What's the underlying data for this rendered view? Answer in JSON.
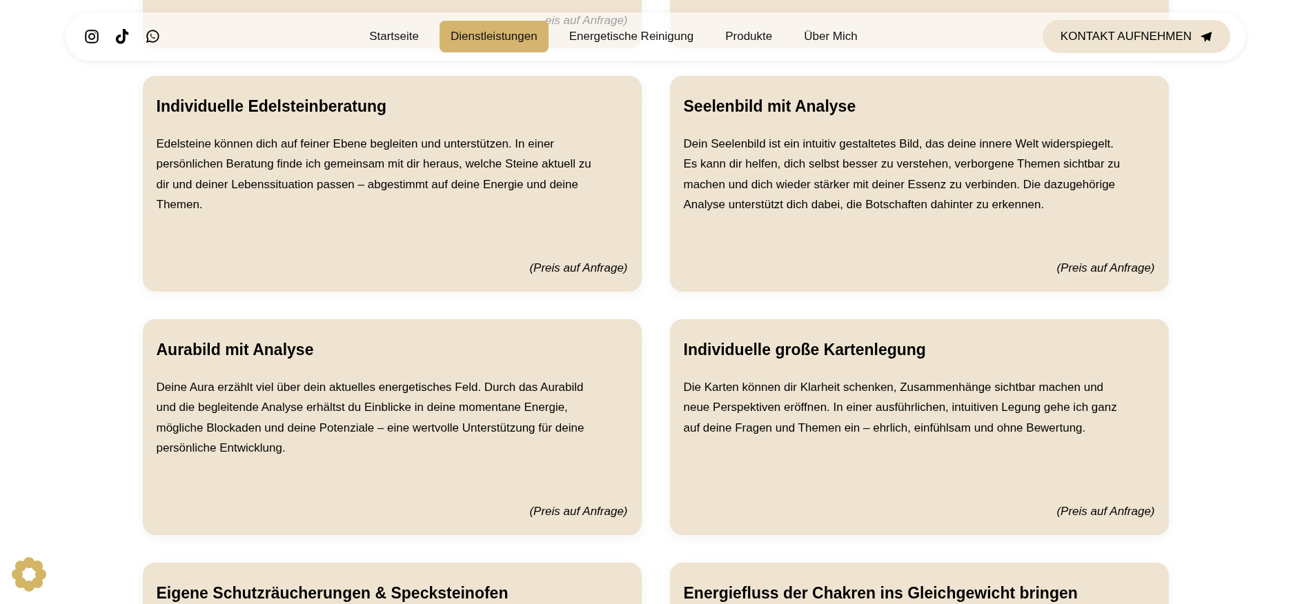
{
  "nav": {
    "links": [
      {
        "label": "Startseite",
        "selected": false
      },
      {
        "label": "Dienstleistungen",
        "selected": true
      },
      {
        "label": "Energetische Reinigung",
        "selected": false
      },
      {
        "label": "Produkte",
        "selected": false
      },
      {
        "label": "Über Mich",
        "selected": false
      }
    ],
    "contact_button": "KONTAKT AUFNEHMEN"
  },
  "top_row": [
    {
      "price": "eis auf Anfrage)"
    }
  ],
  "cards": [
    {
      "title": "Individuelle Edelsteinberatung",
      "text": "Edelsteine können dich auf feiner Ebene begleiten und unterstützen. In einer persönlichen Beratung finde ich gemeinsam mit dir heraus, welche Steine aktuell zu dir und deiner Lebenssituation passen – abgestimmt auf deine Energie und deine Themen.",
      "price": "(Preis auf Anfrage)"
    },
    {
      "title": "Seelenbild mit Analyse",
      "text": "Dein Seelenbild ist ein intuitiv gestaltetes Bild, das deine innere Welt widerspiegelt. Es kann dir helfen, dich selbst besser zu verstehen, verborgene Themen sichtbar zu machen und dich wieder stärker mit deiner Essenz zu verbinden. Die dazugehörige Analyse unterstützt dich dabei, die Botschaften dahinter zu erkennen.",
      "price": "(Preis auf Anfrage)"
    },
    {
      "title": "Aurabild mit Analyse",
      "text": "Deine Aura erzählt viel über dein aktuelles energetisches Feld. Durch das Aurabild und die begleitende Analyse erhältst du Einblicke in deine momentane Energie, mögliche Blockaden und deine Potenziale – eine wertvolle Unterstützung für deine persönliche Entwicklung.",
      "price": "(Preis auf Anfrage)"
    },
    {
      "title": "Individuelle große Kartenlegung",
      "text": "Die Karten können dir Klarheit schenken, Zusammenhänge sichtbar machen und neue Perspektiven eröffnen. In einer ausführlichen, intuitiven Legung gehe ich ganz auf deine Fragen und Themen ein – ehrlich, einfühlsam und ohne Bewertung.",
      "price": "(Preis auf Anfrage)"
    },
    {
      "title": "Eigene Schutzräucherungen & Specksteinofen"
    },
    {
      "title": "Energiefluss der Chakren ins Gleichgewicht bringen"
    }
  ]
}
